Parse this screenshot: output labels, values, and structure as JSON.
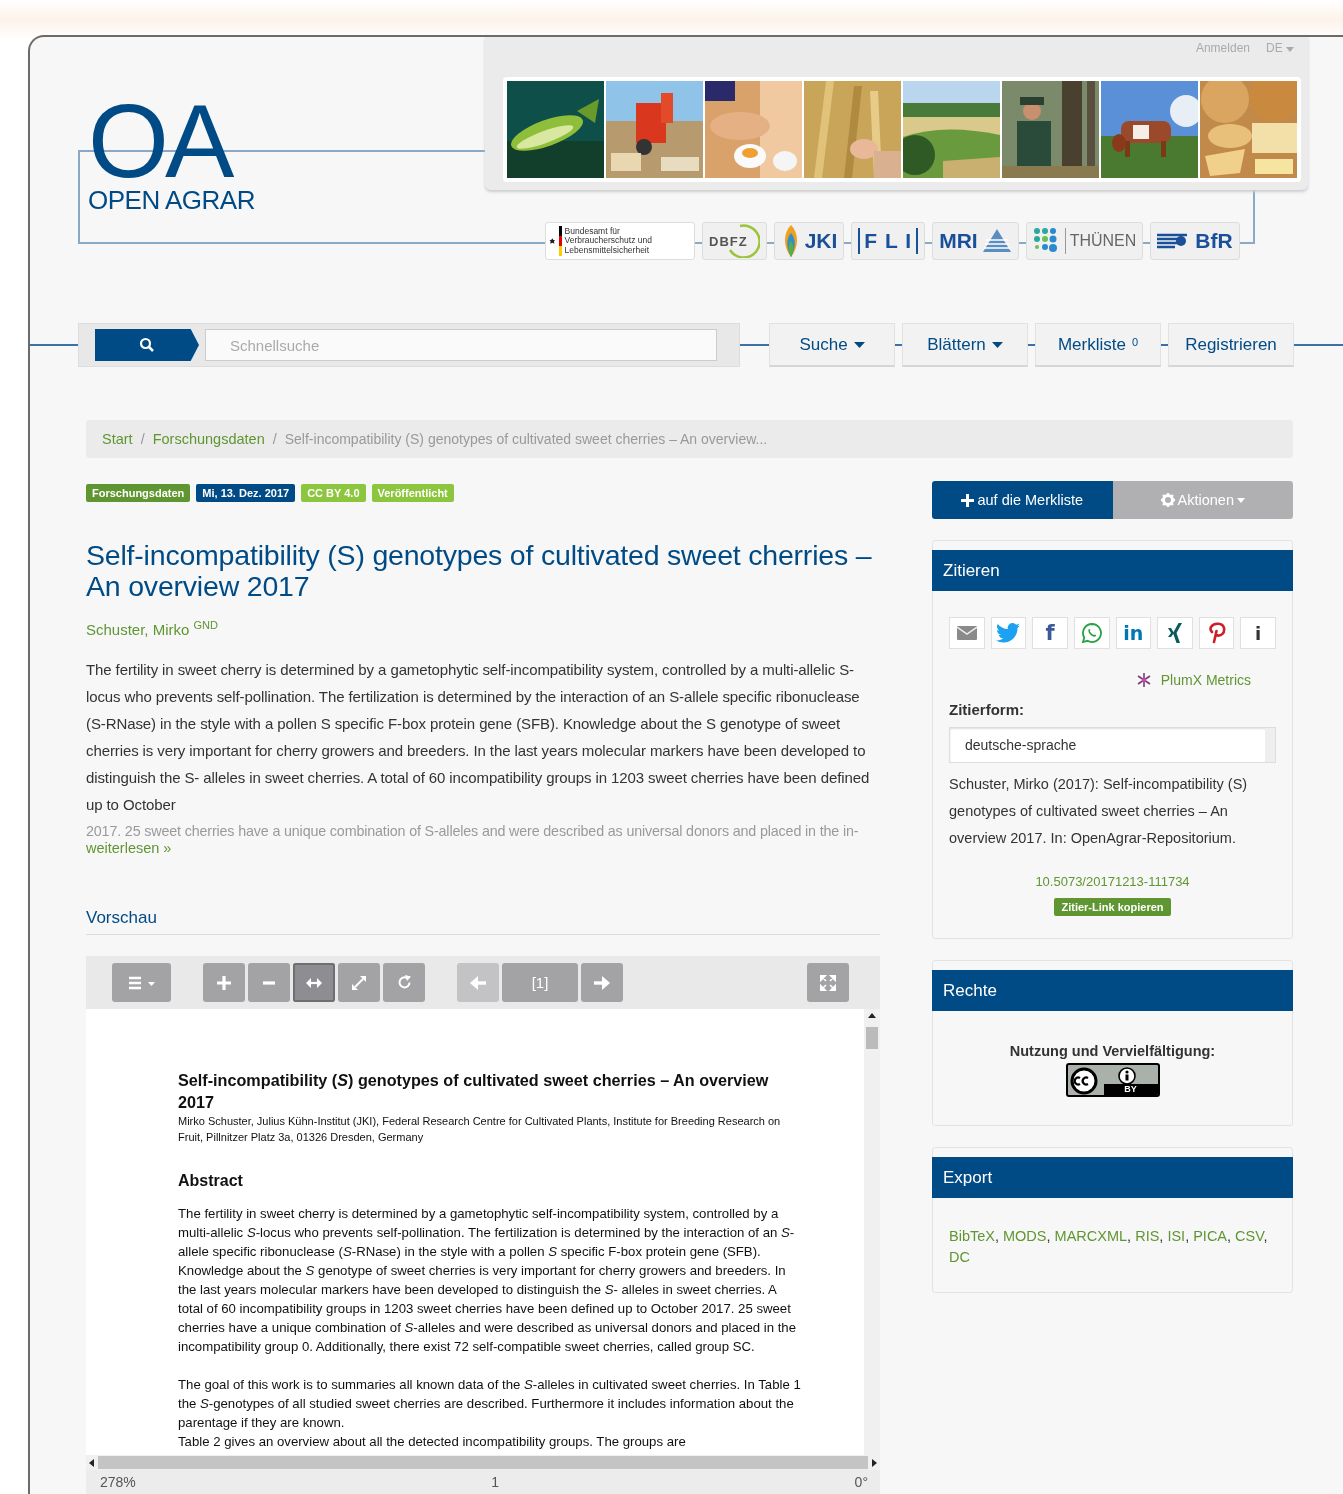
{
  "header": {
    "logo_mark": "OA",
    "logo_text": "OPEN AGRAR",
    "user_links": [
      {
        "label": "Anmelden",
        "kind": "link"
      },
      {
        "label": "DE",
        "kind": "dropdown"
      }
    ],
    "partners": [
      {
        "kind": "bvl",
        "label": "Bundesamt für Verbraucherschutz und Lebensmittelsicherheit"
      },
      {
        "kind": "dbfz",
        "label": "DBFZ"
      },
      {
        "kind": "jki",
        "label": "JKI"
      },
      {
        "kind": "fli",
        "label": "F L I"
      },
      {
        "kind": "mri",
        "label": "MRI"
      },
      {
        "kind": "thuenen",
        "label": "THÜNEN"
      },
      {
        "kind": "bfr",
        "label": "BfR"
      }
    ]
  },
  "nav": {
    "search": {
      "placeholder": "Schnellsuche"
    },
    "items": [
      {
        "label": "Suche",
        "kind": "dropdown"
      },
      {
        "label": "Blättern",
        "kind": "dropdown"
      },
      {
        "label": "Merkliste",
        "kind": "counter",
        "count": "0"
      },
      {
        "label": "Registrieren",
        "kind": "link"
      }
    ]
  },
  "breadcrumb": [
    {
      "label": "Start",
      "kind": "link"
    },
    {
      "label": "Forschungsdaten",
      "kind": "link",
      "separator": "/"
    },
    {
      "separator": "/",
      "label": "Self-incompatibility (S) genotypes of cultivated sweet cherries – An overview...",
      "kind": "current"
    }
  ],
  "badges": [
    {
      "label": "Forschungsdaten",
      "color": "#5f9632"
    },
    {
      "label": "Mi, 13. Dez. 2017",
      "color": "#004b85"
    },
    {
      "label": "CC BY 4.0",
      "color": "#8cc63e"
    },
    {
      "label": "Veröffentlicht",
      "color": "#8cc63e"
    }
  ],
  "article": {
    "title": "Self-incompatibility (S) genotypes of cultivated sweet cherries – An overview 2017",
    "author": {
      "name": "Schuster, Mirko",
      "authority": "GND"
    },
    "abstract": "The fertility in sweet cherry is determined by a gametophytic self-incompatibility system, controlled by a multi-allelic S-locus who prevents self-pollination. The fertilization is determined by the interaction of an S-allele specific ribonuclease (S-RNase) in the style with a pollen S specific F-box protein gene (SFB). Knowledge about the S genotype of sweet cherries is very important for cherry growers and breeders. In the last years molecular markers have been developed to distinguish the S- alleles in sweet cherries. A total of 60 incompatibility groups in 1203 sweet cherries have been defined up to October",
    "abstract_faded": "2017. 25 sweet cherries have a unique combination of S-alleles and were described as universal donors and placed in the in-",
    "read_more": "weiterlesen »"
  },
  "preview": {
    "heading": "Vorschau",
    "toolbar": [
      {
        "buttons": [
          {
            "kind": "menu",
            "selected": false,
            "disabled": false
          }
        ]
      },
      {
        "buttons": [
          {
            "kind": "zoom-in",
            "selected": false,
            "disabled": false
          },
          {
            "kind": "zoom-out",
            "selected": false,
            "disabled": false
          },
          {
            "kind": "fit-width",
            "selected": true,
            "disabled": false
          },
          {
            "kind": "fit-page",
            "selected": false,
            "disabled": false
          },
          {
            "kind": "rotate",
            "selected": false,
            "disabled": false
          }
        ]
      },
      {
        "buttons": [
          {
            "kind": "previous",
            "selected": false,
            "disabled": true
          },
          {
            "kind": "page",
            "label": "[1]",
            "selected": false,
            "disabled": false
          },
          {
            "kind": "next",
            "selected": false,
            "disabled": false
          }
        ]
      },
      {
        "buttons": [
          {
            "kind": "fullscreen",
            "selected": false,
            "disabled": false
          }
        ]
      }
    ],
    "document": {
      "title": "Self-incompatibility (*S*) genotypes of cultivated sweet cherries – An overview 2017",
      "affiliation": "Mirko Schuster, Julius Kühn-Institut (JKI), Federal Research Centre for Cultivated Plants, Institute for Breeding Research on Fruit, Pillnitzer Platz 3a, 01326 Dresden, Germany",
      "heading": "Abstract",
      "paragraphs": [
        {
          "kind": "block",
          "text": "The fertility in sweet cherry is determined by a gametophytic self-incompatibility system, controlled by a multi-allelic *S*-locus who prevents self-pollination. The fertilization is determined by the interaction of an *S*-allele specific ribonuclease (*S*-RNase) in the style with a pollen *S* specific F-box protein gene (SFB). Knowledge about the *S* genotype of sweet cherries is very important for cherry growers and breeders. In the last years molecular markers have been developed to distinguish the *S*- alleles in sweet cherries. A total of 60 incompatibility groups in 1203 sweet cherries have been defined up to October 2017. 25 sweet cherries have a unique combination of *S*-alleles and were described as universal donors and placed in the incompatibility group 0. Additionally, there exist 72 self-compatible sweet cherries, called group SC."
        },
        {
          "kind": "block",
          "text": "The goal of this work is to summaries all known data of the *S*-alleles in cultivated sweet cherries. In Table 1 the *S*-genotypes of all studied sweet cherries are described.  Furthermore it includes information about the parentage if they are known."
        },
        {
          "kind": "continued",
          "text": "Table 2 gives an overview about all the detected incompatibility groups. The groups are"
        }
      ]
    },
    "status": {
      "zoom": "278%",
      "page": "1",
      "rotation": "0°"
    }
  },
  "sidebar": {
    "actions": [
      {
        "label": "auf die Merkliste",
        "kind": "primary"
      },
      {
        "label": "Aktionen",
        "kind": "dropdown"
      }
    ],
    "cite": {
      "title": "Zitieren",
      "share": [
        {
          "kind": "email"
        },
        {
          "kind": "twitter"
        },
        {
          "kind": "facebook",
          "glyph": "f"
        },
        {
          "kind": "whatsapp"
        },
        {
          "kind": "linkedin",
          "glyph": "in"
        },
        {
          "kind": "xing"
        },
        {
          "kind": "pinterest"
        },
        {
          "kind": "info",
          "glyph": "i"
        }
      ],
      "metrics": "PlumX Metrics",
      "style_label": "Zitierform:",
      "style_value": "deutsche-sprache",
      "citation": "Schuster, Mirko (2017): Self-incompatibility (S) genotypes of cultivated sweet cherries – An overview 2017. In: OpenAgrar-Repositorium.",
      "doi": "10.5073/20171213-111734",
      "copy_button": "Zitier-Link kopieren"
    },
    "rights": {
      "title": "Rechte",
      "label": "Nutzung und Vervielfältigung:",
      "license": {
        "kind": "cc-by",
        "label": "BY"
      }
    },
    "export": {
      "title": "Export",
      "separator": ",",
      "formats": [
        "BibTeX",
        "MODS",
        "MARCXML",
        "RIS",
        "ISI",
        "PICA",
        "CSV",
        "DC"
      ]
    }
  }
}
